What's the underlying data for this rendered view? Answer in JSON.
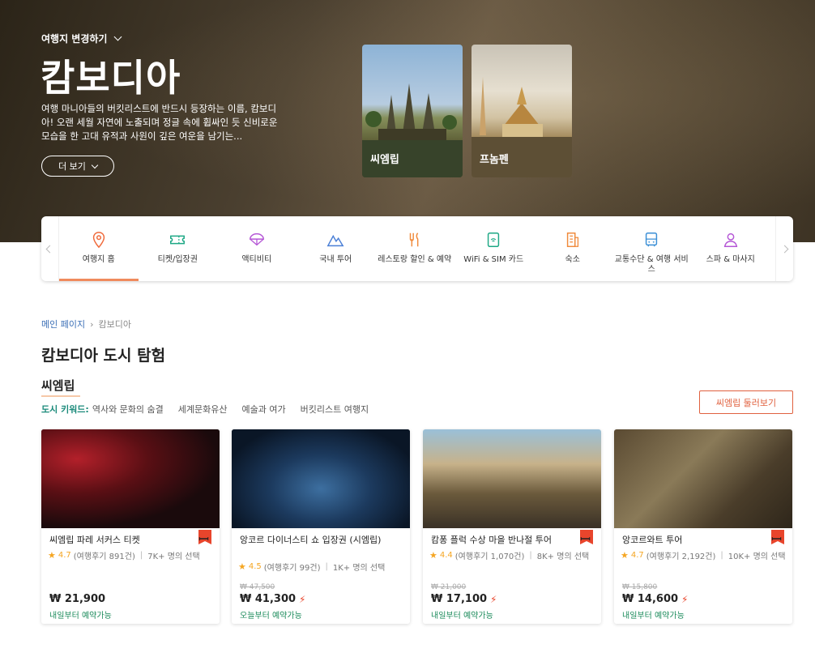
{
  "hero": {
    "change_destination": "여행지 변경하기",
    "title": "캄보디아",
    "description": "여행 마니아들의 버킷리스트에 반드시 등장하는 이름, 캄보디아! 오랜 세월 자연에 노출되며 정글 속에 휩싸인 듯 신비로운 모습을 한 고대 유적과 사원이 깊은 여운을 남기는...",
    "more_label": "더 보기",
    "cities": [
      {
        "label": "씨엠립"
      },
      {
        "label": "프놈펜"
      }
    ]
  },
  "categories": [
    {
      "label": "여행지 홈",
      "icon": "map-pin-icon",
      "color": "#f06a3b",
      "active": true
    },
    {
      "label": "티켓/입장권",
      "icon": "ticket-icon",
      "color": "#1ea885"
    },
    {
      "label": "액티비티",
      "icon": "parachute-icon",
      "color": "#b557d6"
    },
    {
      "label": "국내 투어",
      "icon": "mountain-icon",
      "color": "#4a7fd6"
    },
    {
      "label": "레스토랑 할인 & 예약",
      "icon": "utensils-icon",
      "color": "#f08a3b"
    },
    {
      "label": "WiFi & SIM 카드",
      "icon": "sim-icon",
      "color": "#1ea885"
    },
    {
      "label": "숙소",
      "icon": "building-icon",
      "color": "#f08a3b"
    },
    {
      "label": "교통수단 & 여행 서비스",
      "icon": "bus-icon",
      "color": "#3b8fd6"
    },
    {
      "label": "스파 & 마사지",
      "icon": "spa-icon",
      "color": "#b557d6"
    }
  ],
  "breadcrumb": {
    "home": "메인 페이지",
    "current": "캄보디아"
  },
  "page_title": "캄보디아 도시 탐험",
  "section": {
    "title": "씨엠립",
    "keyword_label": "도시 키워드:",
    "keywords": [
      "역사와 문화의 숨결",
      "세계문화유산",
      "예술과 여가",
      "버킷리스트 여행지"
    ],
    "explore_label": "씨엠립 둘러보기"
  },
  "products": [
    {
      "name": "씨엠립 파레 서커스 티켓",
      "rating": "4.7",
      "reviews": "(여행후기 891건)",
      "booked": "7K+ 명의 선택",
      "old_price": "",
      "price": "₩ 21,900",
      "instant": false,
      "availability": "내일부터 예약가능"
    },
    {
      "name": "앙코르 다이너스티 쇼 입장권 (시엠립)",
      "rating": "4.5",
      "reviews": "(여행후기 99건)",
      "booked": "1K+ 명의 선택",
      "old_price": "₩ 47,500",
      "price": "₩ 41,300",
      "instant": true,
      "availability": "오늘부터 예약가능"
    },
    {
      "name": "캄퐁 플럭 수상 마을 반나절 투어",
      "rating": "4.4",
      "reviews": "(여행후기 1,070건)",
      "booked": "8K+ 명의 선택",
      "old_price": "₩ 21,000",
      "price": "₩ 17,100",
      "instant": true,
      "availability": "내일부터 예약가능"
    },
    {
      "name": "앙코르와트 투어",
      "rating": "4.7",
      "reviews": "(여행후기 2,192건)",
      "booked": "10K+ 명의 선택",
      "old_price": "₩ 15,800",
      "price": "₩ 14,600",
      "instant": true,
      "availability": "내일부터 예약가능"
    }
  ]
}
